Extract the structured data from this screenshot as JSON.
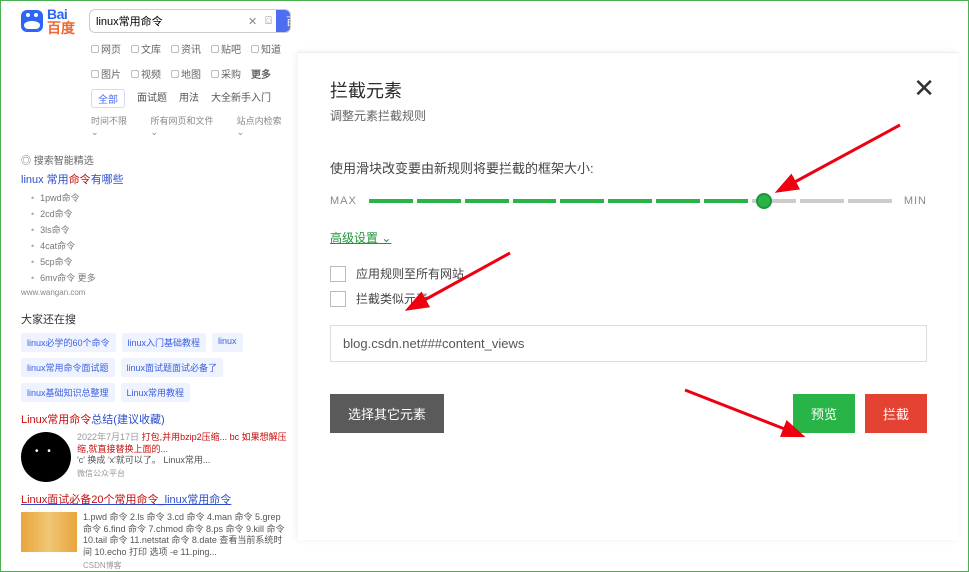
{
  "logo": {
    "top": "Bai",
    "bottom": "百度"
  },
  "search": {
    "query": "linux常用命令",
    "button": "百度一下"
  },
  "tabs": [
    "网页",
    "文库",
    "资讯",
    "贴吧",
    "知道",
    "图片",
    "视频",
    "地图",
    "采购",
    "更多"
  ],
  "filters": {
    "active": "全部",
    "items": [
      "面试题",
      "用法",
      "大全新手入门"
    ]
  },
  "subfilters": [
    "时间不限",
    "所有网页和文件",
    "站点内检索"
  ],
  "smart_section_title": "搜索智能精选",
  "result1": {
    "title_prefix": "linux 常用",
    "title_hl": "命令",
    "title_suffix": "有哪些",
    "list": [
      "1pwd命令",
      "2cd命令",
      "3ls命令",
      "4cat命令",
      "5cp命令",
      "6mv命令 更多"
    ],
    "src": "www.wangan.com"
  },
  "also_viewed": "大家还在搜",
  "tags": [
    "linux必学的60个命令",
    "linux入门基础教程",
    "linux",
    "linux常用命令面试题",
    "linux面试题面试必备了",
    "linux基础知识总整理",
    "Linux常用教程"
  ],
  "result2": {
    "title_prefix": "Linux常用",
    "title_hl": "命令",
    "title_suffix": "总结(建议收藏)",
    "date": "2022年7月17日",
    "snippet_a": "打包,并用bzip2压缩... bc 如果想解压缩,就直接替换上面的...",
    "snippet_b": "'c' 换成 'x'就可以了。 Linux常用...",
    "meta": "微信公众平台"
  },
  "result3": {
    "title_a": "Linux面试必备20个常用",
    "title_hl": "命令",
    "title_b": "_linux常用命令",
    "snippet": "1.pwd 命令 2.ls 命令 3.cd 命令 4.man 命令 5.grep 命令 6.find 命令 7.chmod 命令 8.ps 命令 9.kill 命令 10.tail 命令 11.netstat 命令 8.date 查看当前系统时间 10.echo 打印 选项 -e 11.ping...",
    "meta": "CSDN博客"
  },
  "modal": {
    "title": "拦截元素",
    "subtitle": "调整元素拦截规则",
    "slider_label": "使用滑块改变要由新规则将要拦截的框架大小:",
    "max": "MAX",
    "min": "MIN",
    "advanced": "高级设置",
    "cb1": "应用规则至所有网站",
    "cb2": "拦截类似元素",
    "rule_value": "blog.csdn.net###content_views",
    "btn_other": "选择其它元素",
    "btn_preview": "预览",
    "btn_block": "拦截"
  }
}
